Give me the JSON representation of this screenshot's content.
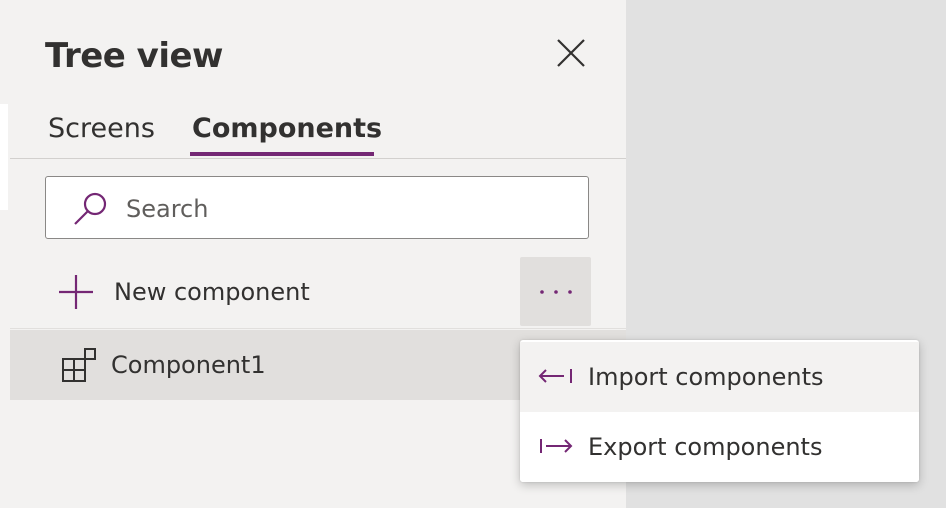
{
  "panel": {
    "title": "Tree view"
  },
  "tabs": [
    {
      "label": "Screens",
      "selected": false
    },
    {
      "label": "Components",
      "selected": true
    }
  ],
  "search": {
    "placeholder": "Search",
    "value": ""
  },
  "new_component": {
    "label": "New component",
    "more_icon": "more-icon"
  },
  "components": [
    {
      "label": "Component1",
      "icon": "component-icon"
    }
  ],
  "context_menu": {
    "items": [
      {
        "label": "Import components",
        "icon": "import-arrow-icon"
      },
      {
        "label": "Export components",
        "icon": "export-arrow-icon"
      }
    ]
  },
  "colors": {
    "accent": "#742774",
    "panel_bg": "#f3f2f1",
    "selected_row_bg": "#e1dfdd",
    "canvas_bg": "#e1e1e1"
  }
}
